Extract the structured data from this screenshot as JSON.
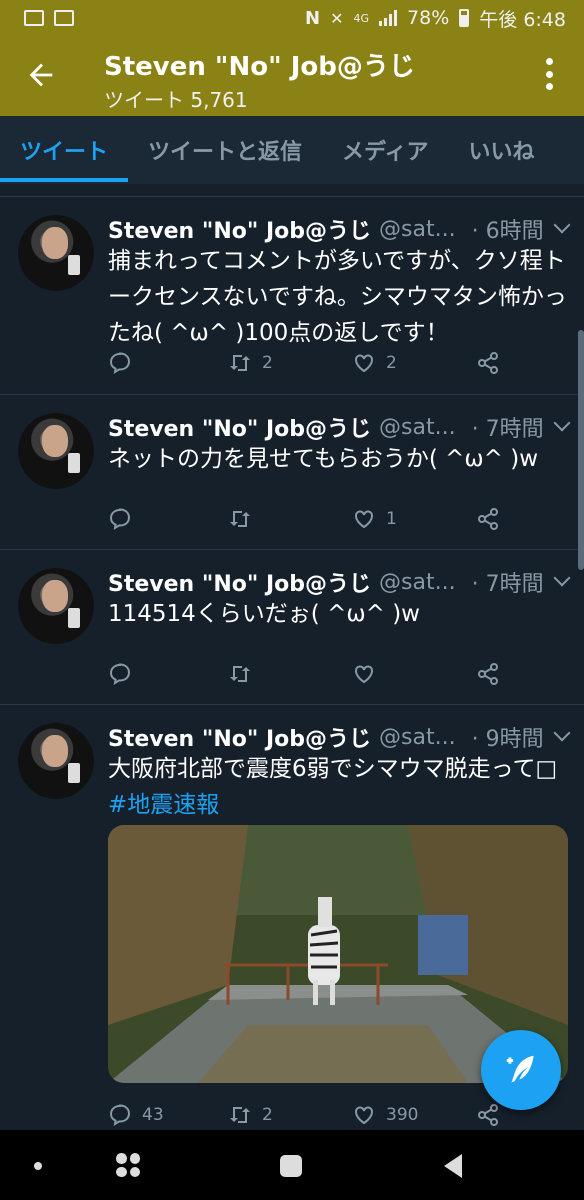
{
  "status_bar": {
    "battery": "78%",
    "time": "午後 6:48",
    "network": "4G"
  },
  "header": {
    "title": "Steven  \"No\" Job@うじ",
    "subtitle": "ツイート 5,761"
  },
  "tabs": [
    {
      "label": "ツイート",
      "active": true
    },
    {
      "label": "ツイートと返信",
      "active": false
    },
    {
      "label": "メディア",
      "active": false
    },
    {
      "label": "いいね",
      "active": false
    }
  ],
  "tweets": [
    {
      "name": "Steven  \"No\" Job@うじ",
      "handle": "@sat...",
      "time": "· 6時間",
      "text": "捕まれってコメントが多いですが、クソ程トークセンスないですね。シマウマタン怖かったね( ^ω^ )100点の返しです！",
      "replies": "",
      "retweets": "2",
      "likes": "2"
    },
    {
      "name": "Steven  \"No\" Job@うじ",
      "handle": "@sat...",
      "time": "· 7時間",
      "text": "ネットの力を見せてもらおうか( ^ω^ )w",
      "replies": "",
      "retweets": "",
      "likes": "1"
    },
    {
      "name": "Steven  \"No\" Job@うじ",
      "handle": "@sat...",
      "time": "· 7時間",
      "text": "114514くらいだぉ( ^ω^ )w",
      "replies": "",
      "retweets": "",
      "likes": ""
    },
    {
      "name": "Steven  \"No\" Job@うじ",
      "handle": "@sat...",
      "time": "· 9時間",
      "text": "大阪府北部で震度6弱でシマウマ脱走って□",
      "hashtag": "#地震速報",
      "replies": "43",
      "retweets": "2",
      "likes": "390"
    }
  ],
  "colors": {
    "header_bg": "#8a8214",
    "background": "#15202b",
    "accent": "#1da1f2",
    "secondary_text": "#8899a6"
  },
  "icons": [
    "back-arrow-icon",
    "more-vert-icon",
    "reply-icon",
    "retweet-icon",
    "like-icon",
    "share-icon",
    "compose-icon"
  ]
}
